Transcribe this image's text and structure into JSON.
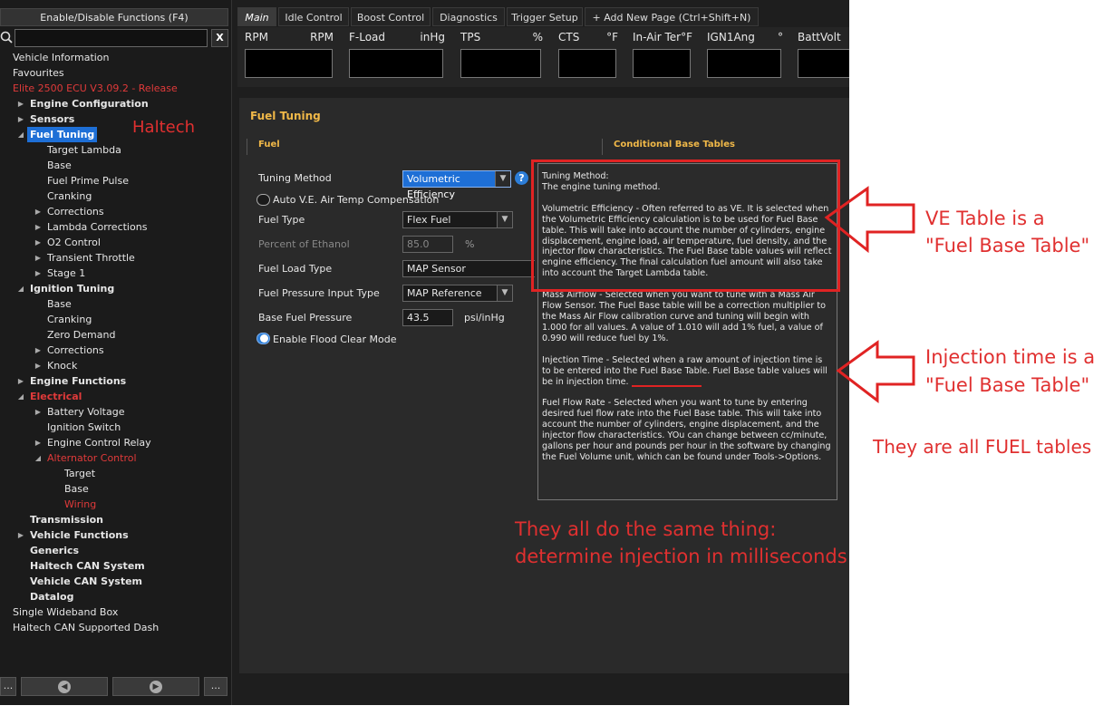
{
  "sidebar": {
    "enable_button": "Enable/Disable Functions (F4)",
    "search_placeholder": "",
    "clear_label": "X",
    "tree": [
      {
        "label": "Vehicle Information",
        "level": 0,
        "arrow": "none",
        "style": "normal"
      },
      {
        "label": "Favourites",
        "level": 0,
        "arrow": "none",
        "style": "normal"
      },
      {
        "label": "Elite 2500 ECU V3.09.2 - Release",
        "level": 0,
        "arrow": "none",
        "style": "red"
      },
      {
        "label": "Engine Configuration",
        "level": 1,
        "arrow": "collapsed",
        "style": "bold"
      },
      {
        "label": "Sensors",
        "level": 1,
        "arrow": "collapsed",
        "style": "bold"
      },
      {
        "label": "Fuel Tuning",
        "level": 1,
        "arrow": "expanded",
        "style": "selected"
      },
      {
        "label": "Target Lambda",
        "level": 2,
        "arrow": "none",
        "style": "normal"
      },
      {
        "label": "Base",
        "level": 2,
        "arrow": "none",
        "style": "normal"
      },
      {
        "label": "Fuel Prime Pulse",
        "level": 2,
        "arrow": "none",
        "style": "normal"
      },
      {
        "label": "Cranking",
        "level": 2,
        "arrow": "none",
        "style": "normal"
      },
      {
        "label": "Corrections",
        "level": 2,
        "arrow": "collapsed",
        "style": "normal"
      },
      {
        "label": "Lambda Corrections",
        "level": 2,
        "arrow": "collapsed",
        "style": "normal"
      },
      {
        "label": "O2 Control",
        "level": 2,
        "arrow": "collapsed",
        "style": "normal"
      },
      {
        "label": "Transient Throttle",
        "level": 2,
        "arrow": "collapsed",
        "style": "normal"
      },
      {
        "label": "Stage 1",
        "level": 2,
        "arrow": "collapsed",
        "style": "normal"
      },
      {
        "label": "Ignition Tuning",
        "level": 1,
        "arrow": "expanded",
        "style": "bold"
      },
      {
        "label": "Base",
        "level": 2,
        "arrow": "none",
        "style": "normal"
      },
      {
        "label": "Cranking",
        "level": 2,
        "arrow": "none",
        "style": "normal"
      },
      {
        "label": "Zero Demand",
        "level": 2,
        "arrow": "none",
        "style": "normal"
      },
      {
        "label": "Corrections",
        "level": 2,
        "arrow": "collapsed",
        "style": "normal"
      },
      {
        "label": "Knock",
        "level": 2,
        "arrow": "collapsed",
        "style": "normal"
      },
      {
        "label": "Engine Functions",
        "level": 1,
        "arrow": "collapsed",
        "style": "bold"
      },
      {
        "label": "Electrical",
        "level": 1,
        "arrow": "expanded",
        "style": "bold-red"
      },
      {
        "label": "Battery Voltage",
        "level": 2,
        "arrow": "collapsed",
        "style": "normal"
      },
      {
        "label": "Ignition Switch",
        "level": 2,
        "arrow": "none",
        "style": "normal"
      },
      {
        "label": "Engine Control Relay",
        "level": 2,
        "arrow": "collapsed",
        "style": "normal"
      },
      {
        "label": "Alternator Control",
        "level": 2,
        "arrow": "expanded",
        "style": "red"
      },
      {
        "label": "Target",
        "level": 3,
        "arrow": "none",
        "style": "normal"
      },
      {
        "label": "Base",
        "level": 3,
        "arrow": "none",
        "style": "normal"
      },
      {
        "label": "Wiring",
        "level": 3,
        "arrow": "none",
        "style": "red"
      },
      {
        "label": "Transmission",
        "level": 1,
        "arrow": "none",
        "style": "bold"
      },
      {
        "label": "Vehicle Functions",
        "level": 1,
        "arrow": "collapsed",
        "style": "bold"
      },
      {
        "label": "Generics",
        "level": 1,
        "arrow": "none",
        "style": "bold"
      },
      {
        "label": "Haltech CAN System",
        "level": 1,
        "arrow": "none",
        "style": "bold"
      },
      {
        "label": "Vehicle CAN System",
        "level": 1,
        "arrow": "none",
        "style": "bold"
      },
      {
        "label": "Datalog",
        "level": 1,
        "arrow": "none",
        "style": "bold"
      },
      {
        "label": "Single Wideband Box",
        "level": 0,
        "arrow": "none",
        "style": "normal"
      },
      {
        "label": "Haltech CAN Supported Dash",
        "level": 0,
        "arrow": "none",
        "style": "normal"
      }
    ],
    "bottom_buttons": [
      "...",
      "...",
      "..."
    ]
  },
  "tabs": [
    {
      "label": "Main",
      "active": true
    },
    {
      "label": "Idle Control",
      "active": false
    },
    {
      "label": "Boost Control",
      "active": false
    },
    {
      "label": "Diagnostics",
      "active": false
    },
    {
      "label": "Trigger Setup",
      "active": false
    },
    {
      "label": "+ Add New Page (Ctrl+Shift+N)",
      "active": false
    }
  ],
  "gauges": [
    {
      "name": "RPM",
      "unit": "RPM"
    },
    {
      "name": "F-Load",
      "unit": "inHg"
    },
    {
      "name": "TPS",
      "unit": "%"
    },
    {
      "name": "CTS",
      "unit": "°F"
    },
    {
      "name": "In-Air Ter",
      "unit": "°F"
    },
    {
      "name": "IGN1Ang",
      "unit": "°"
    },
    {
      "name": "BattVolt",
      "unit": ""
    }
  ],
  "panel": {
    "title": "Fuel Tuning",
    "section_fuel": "Fuel",
    "section_conditional": "Conditional Base Tables",
    "tuning_method_label": "Tuning Method",
    "tuning_method_value": "Volumetric Efficiency",
    "help_icon": "?",
    "auto_ve_label": "Auto V.E. Air Temp Compensation",
    "fuel_type_label": "Fuel Type",
    "fuel_type_value": "Flex Fuel",
    "ethanol_label": "Percent of Ethanol",
    "ethanol_value": "85.0",
    "ethanol_unit": "%",
    "fuel_load_label": "Fuel Load Type",
    "fuel_load_value": "MAP Sensor",
    "fuel_pressure_input_label": "Fuel Pressure Input Type",
    "fuel_pressure_input_value": "MAP Reference",
    "base_pressure_label": "Base Fuel Pressure",
    "base_pressure_value": "43.5",
    "base_pressure_unit": "psi/inHg",
    "flood_clear_label": "Enable Flood Clear Mode"
  },
  "tooltip": {
    "title": "Tuning Method:",
    "desc": "The engine tuning method.",
    "ve": "Volumetric Efficiency - Often referred to as VE. It is selected when the Volumetric Efficiency calculation is to be used for Fuel Base table. This will take into account the number of cylinders, engine displacement, engine load, air temperature, fuel density, and the injector flow characteristics. The Fuel Base table values will reflect engine efficiency. The final calculation fuel amount will also take into account the Target Lambda table.",
    "maf": "Mass Airflow - Selected when you want to tune with a Mass Air Flow Sensor. The Fuel Base table will be a correction multiplier to the Mass Air Flow calibration curve and tuning will begin with 1.000 for all values. A value of 1.010 will add 1% fuel, a value of 0.990 will reduce fuel by 1%.",
    "injection": "Injection Time - Selected when a raw amount of injection time is to be entered into the Fuel Base Table.  Fuel Base table values will be in injection time.",
    "flow": "Fuel Flow Rate - Selected when you want to tune by entering desired fuel flow rate into the Fuel Base table. This will take into account the number of cylinders, engine displacement, and the injector flow characteristics. YOu can change between cc/minute, gallons per hour and pounds per hour in the software by changing the Fuel Volume unit, which can be found under Tools->Options."
  },
  "annotations": {
    "haltech": "Haltech",
    "ve_line1": "VE Table is a",
    "ve_line2": "\"Fuel Base Table\"",
    "inj_line1": "Injection time is a",
    "inj_line2": "\"Fuel Base Table\"",
    "all_fuel": "They are all FUEL tables",
    "same_line1": "They all do the same thing:",
    "same_line2": "determine injection in milliseconds",
    "color": "#e03030"
  }
}
